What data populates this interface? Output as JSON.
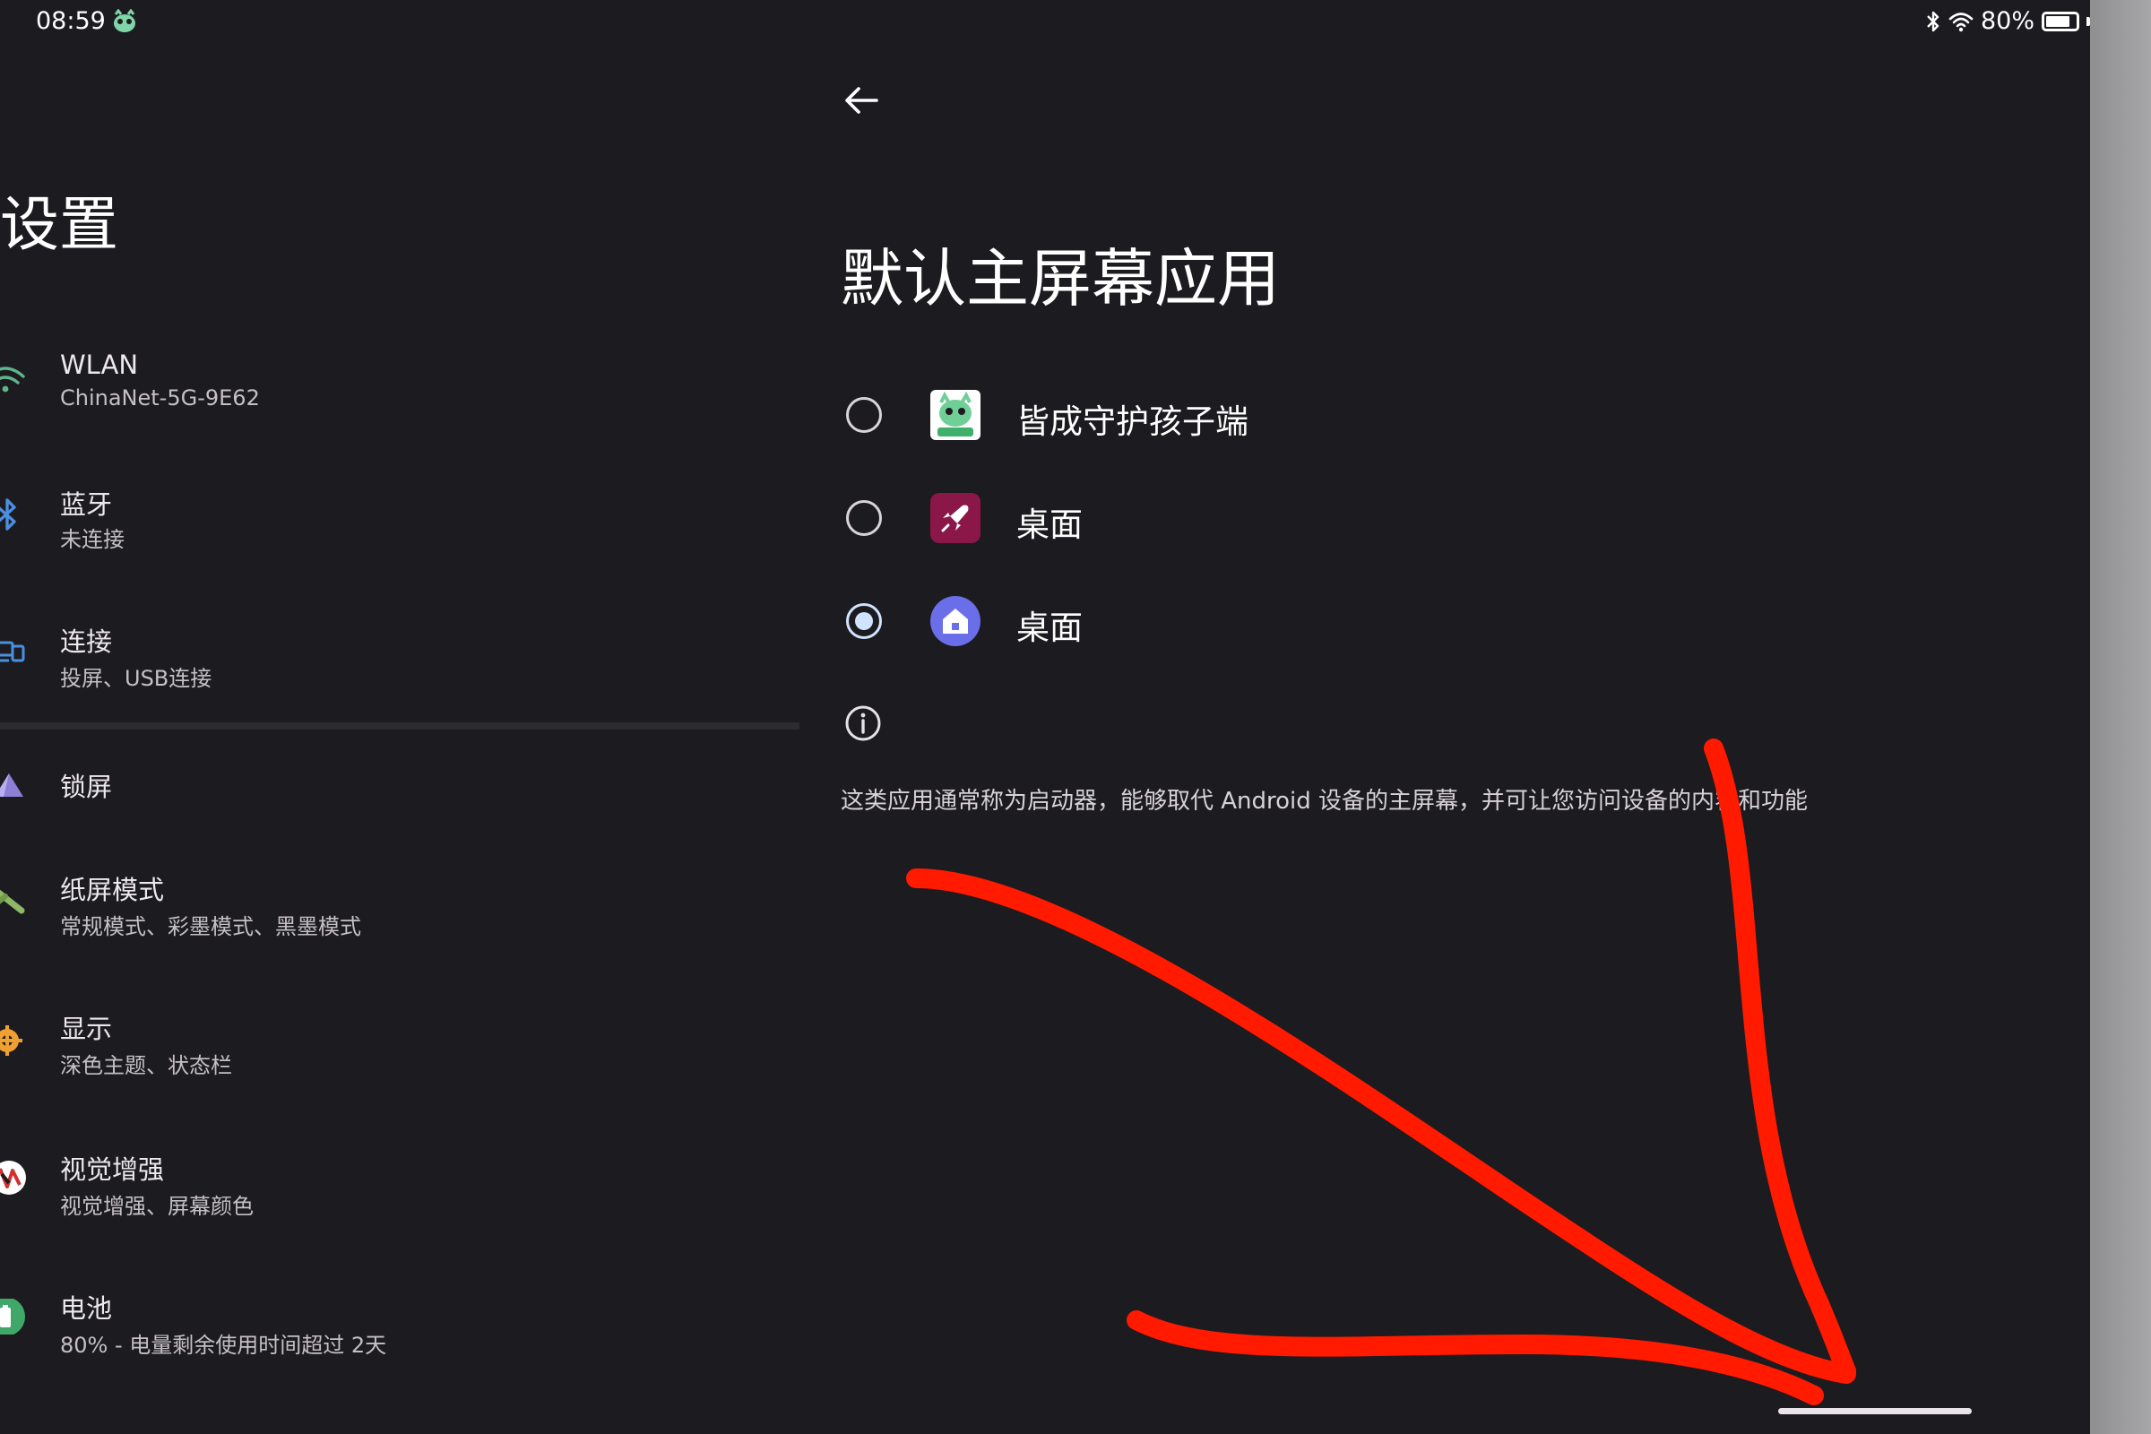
{
  "status_bar": {
    "time": "08:59",
    "battery": "80%",
    "battery_level": 0.8,
    "icons": [
      "app-status-icon",
      "bluetooth-icon",
      "wifi-icon",
      "battery-icon"
    ]
  },
  "left_pane": {
    "title": "设置",
    "items": [
      {
        "title": "WLAN",
        "subtitle": "ChinaNet-5G-9E62",
        "icon": "wifi-icon"
      },
      {
        "title": "蓝牙",
        "subtitle": "未连接",
        "icon": "bluetooth-icon"
      },
      {
        "title": "连接",
        "subtitle": "投屏、USB连接",
        "icon": "connection-icon"
      },
      {
        "title": "锁屏",
        "subtitle": "",
        "icon": "lock-screen-icon"
      },
      {
        "title": "纸屏模式",
        "subtitle": "常规模式、彩墨模式、黑墨模式",
        "icon": "paper-mode-icon"
      },
      {
        "title": "显示",
        "subtitle": "深色主题、状态栏",
        "icon": "display-icon"
      },
      {
        "title": "视觉增强",
        "subtitle": "视觉增强、屏幕颜色",
        "icon": "visual-enhance-icon"
      },
      {
        "title": "电池",
        "subtitle": "80% - 电量剩余使用时间超过 2天",
        "icon": "battery-icon"
      }
    ]
  },
  "right_pane": {
    "title": "默认主屏幕应用",
    "options": [
      {
        "label": "皆成守护孩子端",
        "checked": false,
        "icon": "guardian-child-app-icon"
      },
      {
        "label": "桌面",
        "checked": false,
        "icon": "launcher-rocket-icon"
      },
      {
        "label": "桌面",
        "checked": true,
        "icon": "launcher-home-icon"
      }
    ],
    "info_text": "这类应用通常称为启动器，能够取代 Android 设备的主屏幕，并可让您访问设备的内容和功能"
  },
  "colors": {
    "background": "#1c1b1f",
    "radio_selected": "#d0e4ff",
    "annotation_red": "#ff1a00"
  }
}
